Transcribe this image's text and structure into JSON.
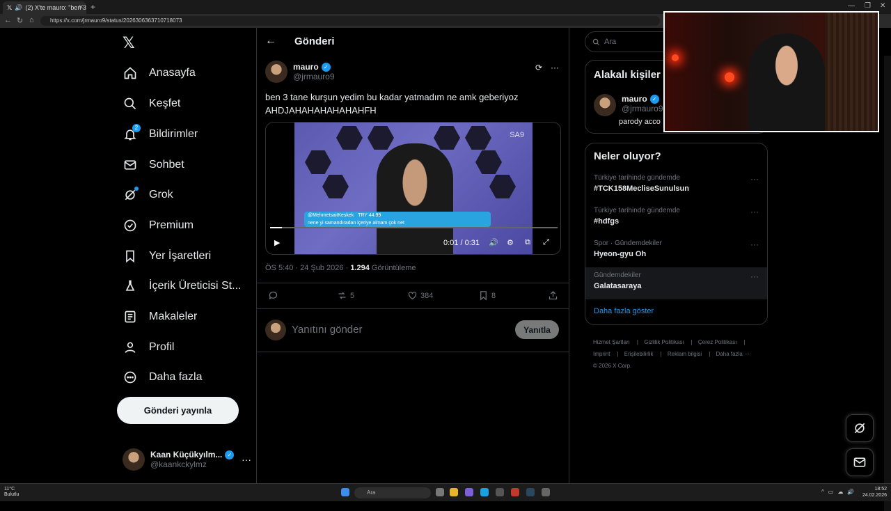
{
  "browser": {
    "tab_title": "(2) X'te mauro: \"ben 3 tane k",
    "url": "https://x.com/jrmauro9/status/2026306363710718073"
  },
  "nav": {
    "items": [
      {
        "label": "Anasayfa"
      },
      {
        "label": "Keşfet"
      },
      {
        "label": "Bildirimler",
        "badge": "2"
      },
      {
        "label": "Sohbet"
      },
      {
        "label": "Grok"
      },
      {
        "label": "Premium"
      },
      {
        "label": "Yer İşaretleri"
      },
      {
        "label": "İçerik Üreticisi St..."
      },
      {
        "label": "Makaleler"
      },
      {
        "label": "Profil"
      },
      {
        "label": "Daha fazla"
      }
    ],
    "post_button": "Gönderi yayınla",
    "account": {
      "name": "Kaan Küçükyılm...",
      "handle": "@kaankckylmz"
    }
  },
  "center": {
    "title": "Gönderi",
    "author": {
      "name": "mauro",
      "handle": "@jrmauro9"
    },
    "text_line1": "ben 3 tane kurşun yedim bu kadar yatmadım ne amk geberiyoz",
    "text_line2": "AHDJAHAHAHAHAHAHFH",
    "video": {
      "watermark": "SA9",
      "overlay_user": "@MehmetsaitKeskek",
      "overlay_amount": "TRY 44.99",
      "overlay_msg": "nene yi samandıradan içeriye almam çok net",
      "time": "0:01 / 0:31",
      "progress": 0.04
    },
    "meta_time": "ÖS 5:40 · 24 Şub 2026 · ",
    "meta_views": "1.294",
    "meta_views_label": " Görüntüleme",
    "actions": {
      "retweets": "5",
      "likes": "384",
      "bookmarks": "8"
    },
    "reply_placeholder": "Yanıtını gönder",
    "reply_button": "Yanıtla"
  },
  "right": {
    "search_placeholder": "Ara",
    "related_title": "Alakalı kişiler",
    "related_user": {
      "name": "mauro",
      "handle": "@jrmauro9",
      "bio": "parody acco"
    },
    "trends_title": "Neler oluyor?",
    "trends": [
      {
        "category": "Türkiye tarihinde gündemde",
        "name": "#TCK158MecliseSunulsun"
      },
      {
        "category": "Türkiye tarihinde gündemde",
        "name": "#hdfgs"
      },
      {
        "category": "Spor · Gündemdekiler",
        "name": "Hyeon-gyu Oh"
      },
      {
        "category": "Gündemdekiler",
        "name": "Galatasaraya"
      }
    ],
    "show_more": "Daha fazla göster",
    "footer": [
      "Hizmet Şartları",
      "Gizlilik Politikası",
      "Çerez Politikası",
      "Imprint",
      "Erişilebilirlik",
      "Reklam bilgisi",
      "Daha fazla ···",
      "© 2026 X Corp."
    ]
  },
  "taskbar": {
    "weather_temp": "11°C",
    "weather_desc": "Bulutlu",
    "search": "Ara",
    "time": "18:52",
    "date": "24.02.2026"
  },
  "colors": {
    "accent": "#1d9bf0",
    "bg": "#000000",
    "border": "#2f3336",
    "muted": "#71767b"
  }
}
